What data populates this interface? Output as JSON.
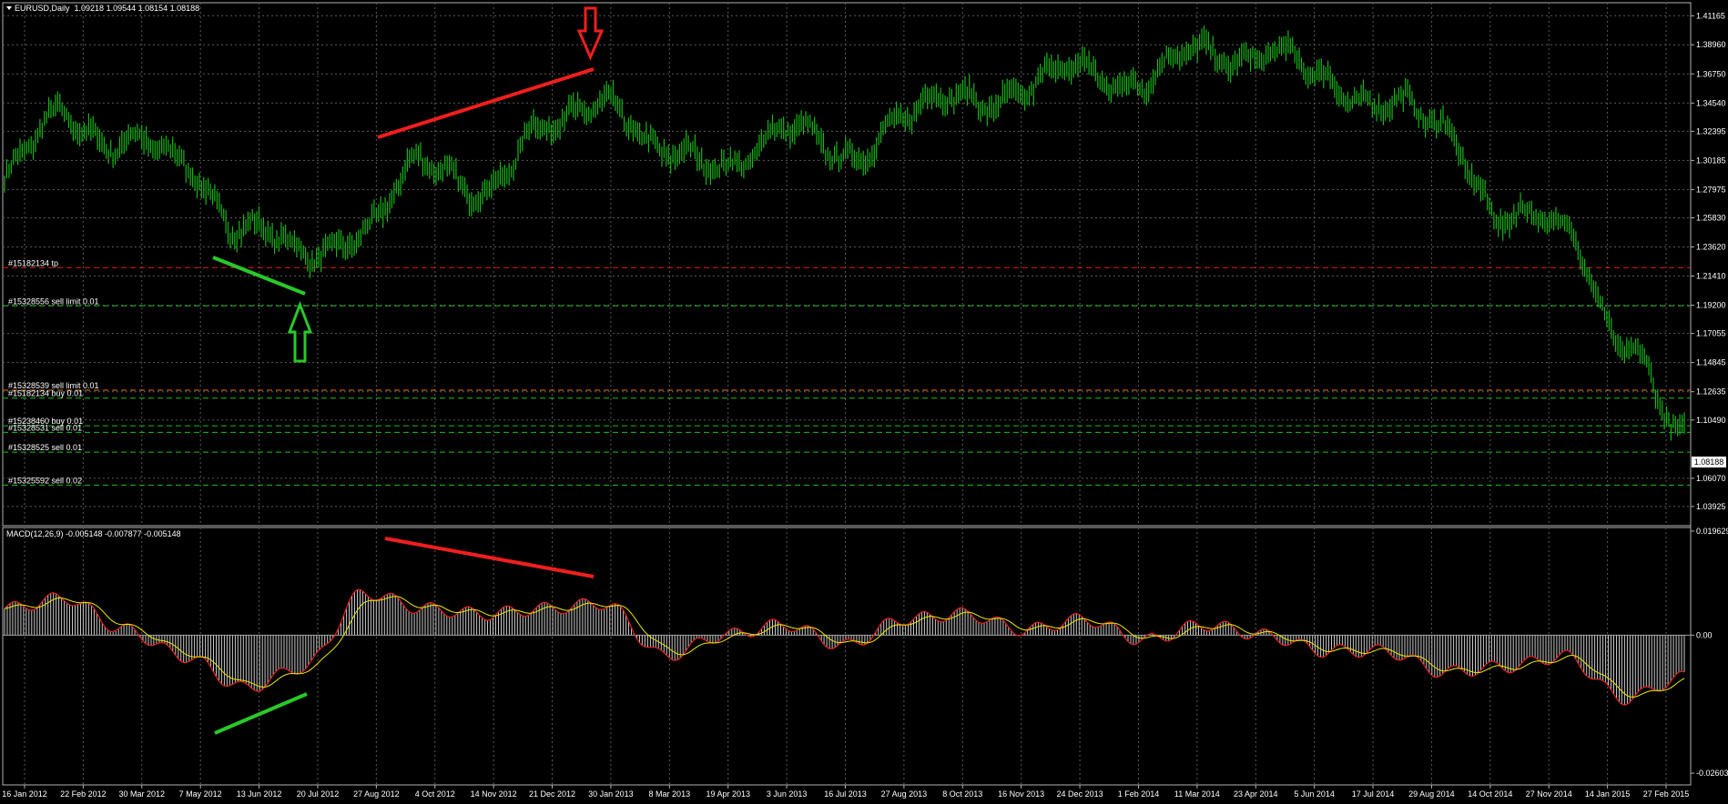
{
  "main_pane": {
    "symbol_timeframe": "EURUSD,Daily",
    "ohlc": "1.09218 1.09544 1.08154 1.08188",
    "price_min": 1.0247,
    "price_max": 1.4215,
    "bid": "1.08188",
    "y_ticks": [
      {
        "label": "1.41165",
        "value": 1.41165
      },
      {
        "label": "1.38960",
        "value": 1.3896
      },
      {
        "label": "1.36750",
        "value": 1.3675
      },
      {
        "label": "1.34540",
        "value": 1.3454
      },
      {
        "label": "1.32395",
        "value": 1.32395
      },
      {
        "label": "1.30185",
        "value": 1.30185
      },
      {
        "label": "1.27975",
        "value": 1.27975
      },
      {
        "label": "1.25830",
        "value": 1.2583
      },
      {
        "label": "1.23620",
        "value": 1.2362
      },
      {
        "label": "1.21410",
        "value": 1.2141
      },
      {
        "label": "1.19200",
        "value": 1.192
      },
      {
        "label": "1.17055",
        "value": 1.17055
      },
      {
        "label": "1.14845",
        "value": 1.14845
      },
      {
        "label": "1.12635",
        "value": 1.12635
      },
      {
        "label": "1.10490",
        "value": 1.1049
      },
      {
        "label": "1.06070",
        "value": 1.0607
      },
      {
        "label": "1.03925",
        "value": 1.03925
      }
    ],
    "order_lines": [
      {
        "label": "#15182134 tp",
        "price": 1.2205,
        "color": "#e0201e"
      },
      {
        "label": "#15328556 sell limit 0.01",
        "price": 1.1915,
        "color": "#18c018"
      },
      {
        "label": "#15328539 sell limit 0.01",
        "price": 1.1275,
        "color": "#e07818"
      },
      {
        "label": "#15182134 buy 0.01",
        "price": 1.1215,
        "color": "#18c018"
      },
      {
        "label": "#15238460 buy 0.01",
        "price": 1.1005,
        "color": "#18c018"
      },
      {
        "label": "#15328531 sell 0.01",
        "price": 1.0955,
        "color": "#18c018"
      },
      {
        "label": "#15328525 sell 0.01",
        "price": 1.0805,
        "color": "#18c018"
      },
      {
        "label": "#15325592 sell 0.02",
        "price": 1.0555,
        "color": "#18c018"
      }
    ]
  },
  "macd_pane": {
    "title": "MACD(12,26,9) -0.005148 -0.007877 -0.005148",
    "min": -0.02825,
    "max": 0.0203,
    "y_ticks": [
      {
        "label": "0.019629",
        "value": 0.019629
      },
      {
        "label": "0.00",
        "value": 0.0
      },
      {
        "label": "-0.026035",
        "value": -0.026035
      }
    ]
  },
  "x_axis_labels": [
    "16 Jan 2012",
    "22 Feb 2012",
    "30 Mar 2012",
    "7 May 2012",
    "13 Jun 2012",
    "20 Jul 2012",
    "27 Aug 2012",
    "4 Oct 2012",
    "14 Nov 2012",
    "21 Dec 2012",
    "30 Jan 2013",
    "8 Mar 2013",
    "19 Apr 2013",
    "3 Jun 2013",
    "16 Jul 2013",
    "27 Aug 2013",
    "8 Oct 2013",
    "16 Nov 2013",
    "24 Dec 2013",
    "1 Feb 2014",
    "11 Mar 2014",
    "23 Apr 2014",
    "5 Jun 2014",
    "17 Jul 2014",
    "29 Aug 2014",
    "14 Oct 2014",
    "27 Nov 2014",
    "14 Jan 2015",
    "27 Feb 2015"
  ],
  "chart_data": {
    "type": "line",
    "title": "EURUSD,Daily",
    "x": [
      "16 Jan 2012",
      "22 Feb 2012",
      "30 Mar 2012",
      "7 May 2012",
      "13 Jun 2012",
      "20 Jul 2012",
      "27 Aug 2012",
      "4 Oct 2012",
      "14 Nov 2012",
      "21 Dec 2012",
      "30 Jan 2013",
      "8 Mar 2013",
      "19 Apr 2013",
      "3 Jun 2013",
      "16 Jul 2013",
      "27 Aug 2013",
      "8 Oct 2013",
      "16 Nov 2013",
      "24 Dec 2013",
      "1 Feb 2014",
      "11 Mar 2014",
      "23 Apr 2014",
      "5 Jun 2014",
      "17 Jul 2014",
      "29 Aug 2014",
      "14 Oct 2014",
      "27 Nov 2014",
      "14 Jan 2015",
      "27 Feb 2015"
    ],
    "series": [
      {
        "name": "EURUSD,Daily",
        "values": [
          1.29,
          1.335,
          1.318,
          1.295,
          1.255,
          1.225,
          1.255,
          1.295,
          1.285,
          1.32,
          1.355,
          1.3,
          1.305,
          1.32,
          1.31,
          1.33,
          1.355,
          1.35,
          1.375,
          1.36,
          1.385,
          1.385,
          1.36,
          1.35,
          1.32,
          1.265,
          1.245,
          1.17,
          1.085
        ]
      },
      {
        "name": "MACD(12,26,9)",
        "values": [
          0.005,
          0.007,
          0.001,
          -0.004,
          -0.01,
          -0.006,
          0.008,
          0.005,
          0.004,
          0.005,
          0.006,
          -0.004,
          0.0,
          0.002,
          -0.002,
          0.003,
          0.004,
          0.001,
          0.003,
          -0.001,
          0.002,
          0.0,
          -0.003,
          -0.003,
          -0.007,
          -0.006,
          -0.004,
          -0.012,
          -0.008
        ]
      }
    ],
    "ylim": [
      1.0247,
      1.4215
    ],
    "grid": true
  }
}
